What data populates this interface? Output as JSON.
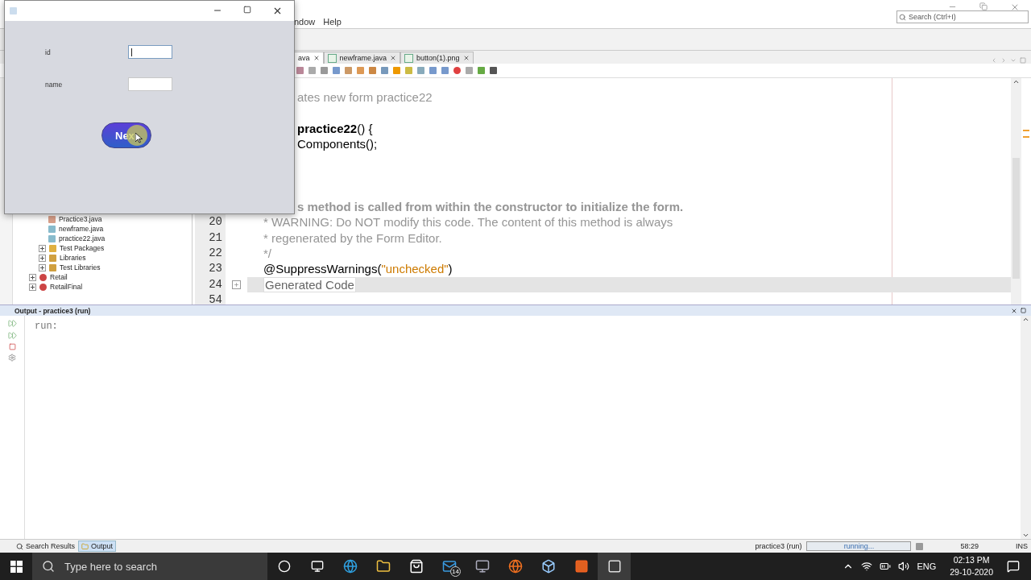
{
  "ide": {
    "menu": [
      "ndow",
      "Help"
    ],
    "search": {
      "placeholder": "Search (Ctrl+I)"
    },
    "editor_tabs": [
      {
        "label": "ava",
        "selected": true
      },
      {
        "label": "newframe.java",
        "selected": false
      },
      {
        "label": "button(1).png",
        "selected": false
      }
    ],
    "tree": [
      {
        "children": [
          {
            "children": [
              {
                "label": "Practice3.java",
                "kind": "main-file"
              },
              {
                "label": "newframe.java",
                "kind": "form-file"
              },
              {
                "label": "practice22.java",
                "kind": "form-file"
              }
            ]
          },
          {
            "label": "Test Packages",
            "kind": "package-folder"
          },
          {
            "label": "Libraries",
            "kind": "library-folder"
          },
          {
            "label": "Test Libraries",
            "kind": "library-folder"
          }
        ]
      },
      {
        "label": "Retail",
        "kind": "project"
      },
      {
        "label": "RetailFinal",
        "kind": "project"
      }
    ],
    "code_lines": [
      {
        "kind": "clipped",
        "segments": [
          {
            "kind": "comment",
            "text": "ates new form practice22"
          }
        ]
      },
      {
        "kind": "blank"
      },
      {
        "kind": "clipped",
        "segments": [
          {
            "kind": "method",
            "text": "practice22"
          },
          {
            "kind": "plain",
            "text": "() {"
          }
        ]
      },
      {
        "kind": "clipped",
        "segments": [
          {
            "kind": "plain",
            "text": "Components();"
          }
        ]
      },
      {
        "kind": "blank"
      },
      {
        "kind": "blank"
      },
      {
        "kind": "blank"
      },
      {
        "kind": "clipped",
        "segments": [
          {
            "kind": "doc-bold",
            "text": "s method is called from within the constructor to initialize the form."
          }
        ]
      },
      {
        "kind": "code",
        "number": "20",
        "segments": [
          {
            "kind": "comment",
            "text": "* WARNING: Do NOT modify this code. The content of this method is always"
          }
        ]
      },
      {
        "kind": "code",
        "number": "21",
        "segments": [
          {
            "kind": "comment",
            "text": "* regenerated by the Form Editor."
          }
        ]
      },
      {
        "kind": "code",
        "number": "22",
        "segments": [
          {
            "kind": "comment",
            "text": "*/"
          }
        ]
      },
      {
        "kind": "code",
        "number": "23",
        "segments": [
          {
            "kind": "plain",
            "text": "@SuppressWarnings("
          },
          {
            "kind": "string",
            "text": "\"unchecked\""
          },
          {
            "kind": "plain",
            "text": ")"
          }
        ]
      },
      {
        "kind": "fold",
        "number": "24",
        "segments": [
          {
            "kind": "folded",
            "text": "Generated Code"
          }
        ]
      },
      {
        "kind": "blank",
        "number": "54"
      }
    ],
    "output": {
      "title": "Output - practice3 (run)",
      "text": "run:"
    },
    "bottom_tabs": [
      {
        "label": "Search Results",
        "selected": false
      },
      {
        "label": "Output",
        "selected": true
      }
    ],
    "status": {
      "task": "practice3 (run)",
      "progress_label": "running...",
      "position": "58:29",
      "mode": "INS"
    }
  },
  "taskbar": {
    "search_placeholder": "Type here to search",
    "mail_badge": "14",
    "language": "ENG",
    "time": "02:13 PM",
    "date": "29-10-2020"
  },
  "dialog": {
    "fields": [
      {
        "label": "id",
        "focused": true
      },
      {
        "label": "name",
        "focused": false
      }
    ],
    "button": "Nex"
  }
}
